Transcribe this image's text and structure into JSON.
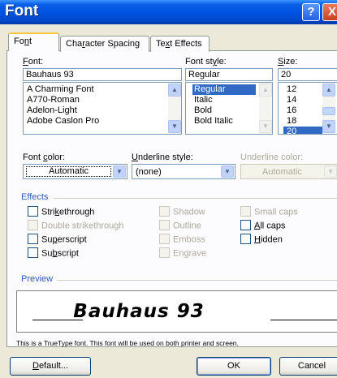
{
  "window": {
    "title": "Font",
    "help_label": "?",
    "close_label": "X"
  },
  "tabs": [
    {
      "pre": "Fo",
      "key": "n",
      "post": "t"
    },
    {
      "pre": "Cha",
      "key": "r",
      "post": "acter Spacing"
    },
    {
      "pre": "Te",
      "key": "x",
      "post": "t Effects"
    }
  ],
  "font": {
    "label_key": "F",
    "label_rest": "ont:",
    "value": "Bauhaus 93",
    "items": [
      "A Charming Font",
      "A770-Roman",
      "Adelon-Light",
      "Adobe Caslon Pro"
    ]
  },
  "style": {
    "label_pre": "Font st",
    "label_key": "y",
    "label_rest": "le:",
    "value": "Regular",
    "items": [
      "Regular",
      "Italic",
      "Bold",
      "Bold Italic"
    ],
    "selected": "Regular"
  },
  "size": {
    "label_key": "S",
    "label_rest": "ize:",
    "value": "20",
    "items": [
      "12",
      "14",
      "16",
      "18",
      "20"
    ],
    "selected": "20"
  },
  "font_color": {
    "label_pre": "Font ",
    "label_key": "c",
    "label_rest": "olor:",
    "value": "Automatic"
  },
  "underline_style": {
    "label_key": "U",
    "label_rest": "nderline style:",
    "value": "(none)"
  },
  "underline_color": {
    "label": "Underline color:",
    "value": "Automatic"
  },
  "effects": {
    "title": "Effects",
    "col1": [
      {
        "pre": "Stri",
        "key": "k",
        "post": "ethrough",
        "disabled": false
      },
      {
        "pre": "Double strikethrough",
        "key": "",
        "post": "",
        "disabled": true
      },
      {
        "pre": "Su",
        "key": "p",
        "post": "erscript",
        "disabled": false
      },
      {
        "pre": "Su",
        "key": "b",
        "post": "script",
        "disabled": false
      }
    ],
    "col2": [
      {
        "label": "Shadow"
      },
      {
        "label": "Outline"
      },
      {
        "label": "Emboss"
      },
      {
        "label": "Engrave"
      }
    ],
    "col3": [
      {
        "pre": "",
        "key": "",
        "post": "Small caps",
        "disabled": true
      },
      {
        "pre": "",
        "key": "A",
        "post": "ll caps",
        "disabled": false
      },
      {
        "pre": "",
        "key": "H",
        "post": "idden",
        "disabled": false
      }
    ]
  },
  "preview": {
    "title": "Preview",
    "sample": "Bauhaus 93",
    "note": "This is a TrueType font. This font will be used on both printer and screen."
  },
  "buttons": {
    "default_key": "D",
    "default_rest": "efault...",
    "ok": "OK",
    "cancel": "Cancel"
  }
}
